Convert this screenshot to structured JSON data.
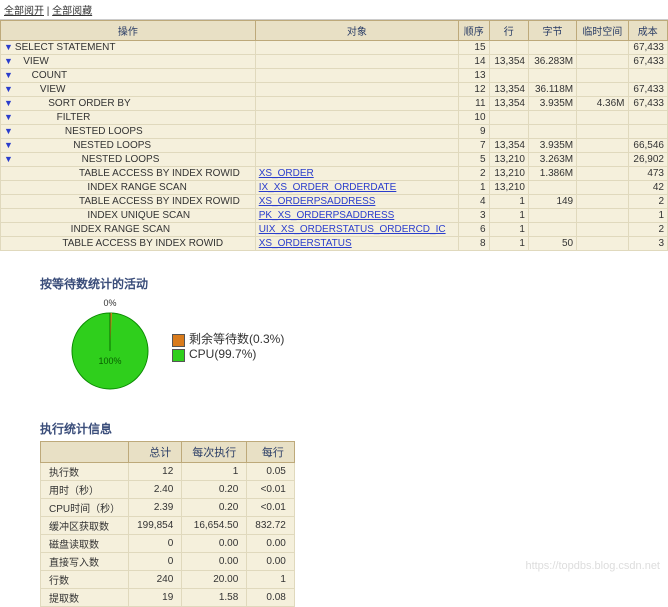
{
  "top_links": {
    "a": "全部阅开",
    "b": "全部阅藏"
  },
  "plan": {
    "headers": [
      "操作",
      "对象",
      "顺序",
      "行",
      "字节",
      "临时空间",
      "成本"
    ],
    "rows": [
      {
        "indent": 0,
        "op": "SELECT STATEMENT",
        "obj": "",
        "ord": "15",
        "rows": "",
        "bytes": "",
        "temp": "",
        "cost": "67,433"
      },
      {
        "indent": 1,
        "op": "VIEW",
        "obj": "",
        "ord": "14",
        "rows": "13,354",
        "bytes": "36.283M",
        "temp": "",
        "cost": "67,433"
      },
      {
        "indent": 2,
        "op": "COUNT",
        "obj": "",
        "ord": "13",
        "rows": "",
        "bytes": "",
        "temp": "",
        "cost": ""
      },
      {
        "indent": 3,
        "op": "VIEW",
        "obj": "",
        "ord": "12",
        "rows": "13,354",
        "bytes": "36.118M",
        "temp": "",
        "cost": "67,433"
      },
      {
        "indent": 4,
        "op": "SORT ORDER BY",
        "obj": "",
        "ord": "11",
        "rows": "13,354",
        "bytes": "3.935M",
        "temp": "4.36M",
        "cost": "67,433"
      },
      {
        "indent": 5,
        "op": "FILTER",
        "obj": "",
        "ord": "10",
        "rows": "",
        "bytes": "",
        "temp": "",
        "cost": ""
      },
      {
        "indent": 6,
        "op": "NESTED LOOPS",
        "obj": "",
        "ord": "9",
        "rows": "",
        "bytes": "",
        "temp": "",
        "cost": ""
      },
      {
        "indent": 7,
        "op": "NESTED LOOPS",
        "obj": "",
        "ord": "7",
        "rows": "13,354",
        "bytes": "3.935M",
        "temp": "",
        "cost": "66,546"
      },
      {
        "indent": 8,
        "op": "NESTED LOOPS",
        "obj": "",
        "ord": "5",
        "rows": "13,210",
        "bytes": "3.263M",
        "temp": "",
        "cost": "26,902"
      },
      {
        "indent": 9,
        "op": "TABLE ACCESS BY INDEX ROWID",
        "obj": "XS_ORDER",
        "ord": "2",
        "rows": "13,210",
        "bytes": "1.386M",
        "temp": "",
        "cost": "473",
        "nt": 1
      },
      {
        "indent": 10,
        "op": "INDEX RANGE SCAN",
        "obj": "IX_XS_ORDER_ORDERDATE",
        "ord": "1",
        "rows": "13,210",
        "bytes": "",
        "temp": "",
        "cost": "42",
        "nt": 1
      },
      {
        "indent": 9,
        "op": "TABLE ACCESS BY INDEX ROWID",
        "obj": "XS_ORDERPSADDRESS",
        "ord": "4",
        "rows": "1",
        "bytes": "149",
        "temp": "",
        "cost": "2",
        "nt": 1
      },
      {
        "indent": 10,
        "op": "INDEX UNIQUE SCAN",
        "obj": "PK_XS_ORDERPSADDRESS",
        "ord": "3",
        "rows": "1",
        "bytes": "",
        "temp": "",
        "cost": "1",
        "nt": 1
      },
      {
        "indent": 8,
        "op": "INDEX RANGE SCAN",
        "obj": "UIX_XS_ORDERSTATUS_ORDERCD_IC",
        "ord": "6",
        "rows": "1",
        "bytes": "",
        "temp": "",
        "cost": "2",
        "nt": 1
      },
      {
        "indent": 7,
        "op": "TABLE ACCESS BY INDEX ROWID",
        "obj": "XS_ORDERSTATUS",
        "ord": "8",
        "rows": "1",
        "bytes": "50",
        "temp": "",
        "cost": "3",
        "nt": 1
      }
    ]
  },
  "section1_title": "按等待数统计的活动",
  "chart_data": {
    "type": "pie",
    "slices": [
      {
        "label": "剩余等待数",
        "pct": 0.3,
        "color": "#d97b1c"
      },
      {
        "label": "CPU",
        "pct": 99.7,
        "color": "#2fcf1c"
      }
    ],
    "top_label": "0%",
    "inner_label": "100%"
  },
  "legend": {
    "a": "剩余等待数(0.3%)",
    "b": "CPU(99.7%)"
  },
  "section2_title": "执行统计信息",
  "stats": {
    "headers": [
      "",
      "总计",
      "每次执行",
      "每行"
    ],
    "rows": [
      {
        "lbl": "执行数",
        "total": "12",
        "per_exec": "1",
        "per_row": "0.05"
      },
      {
        "lbl": "用时（秒）",
        "total": "2.40",
        "per_exec": "0.20",
        "per_row": "<0.01"
      },
      {
        "lbl": "CPU时间（秒）",
        "total": "2.39",
        "per_exec": "0.20",
        "per_row": "<0.01"
      },
      {
        "lbl": "缓冲区获取数",
        "total": "199,854",
        "per_exec": "16,654.50",
        "per_row": "832.72"
      },
      {
        "lbl": "磁盘读取数",
        "total": "0",
        "per_exec": "0.00",
        "per_row": "0.00"
      },
      {
        "lbl": "直接写入数",
        "total": "0",
        "per_exec": "0.00",
        "per_row": "0.00"
      },
      {
        "lbl": "行数",
        "total": "240",
        "per_exec": "20.00",
        "per_row": "1"
      },
      {
        "lbl": "提取数",
        "total": "19",
        "per_exec": "1.58",
        "per_row": "0.08"
      }
    ]
  },
  "watermark": "https://topdbs.blog.csdn.net"
}
